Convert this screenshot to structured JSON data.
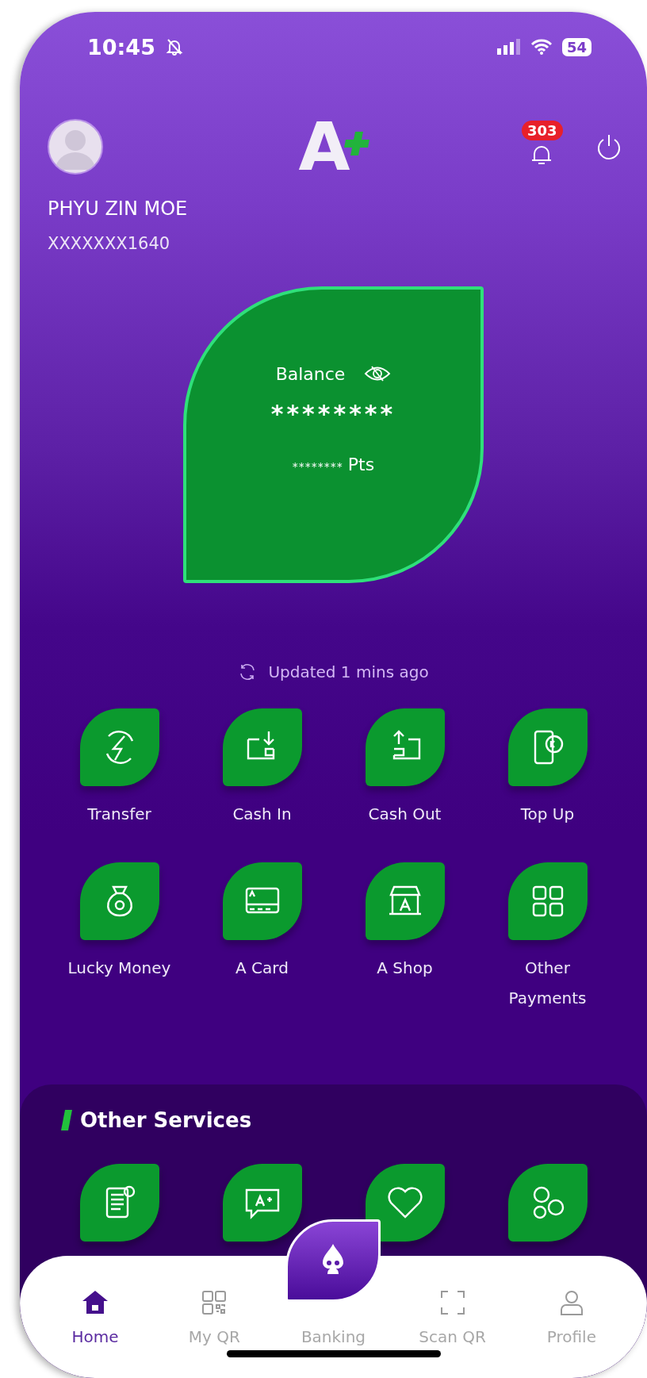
{
  "status_bar": {
    "time": "10:45",
    "battery": "54"
  },
  "header": {
    "logo_letter": "A",
    "notification_count": "303"
  },
  "user": {
    "name": "PHYU ZIN MOE",
    "account": "XXXXXXX1640"
  },
  "balance_card": {
    "label": "Balance",
    "amount": "********",
    "points": "********",
    "points_unit": "Pts"
  },
  "updated": "Updated 1 mins ago",
  "quick_actions": [
    {
      "label": "Transfer",
      "kind": "transfer"
    },
    {
      "label": "Cash In",
      "kind": "cash-in"
    },
    {
      "label": "Cash Out",
      "kind": "cash-out"
    },
    {
      "label": "Top Up",
      "kind": "top-up"
    },
    {
      "label": "Lucky Money",
      "kind": "money-bag"
    },
    {
      "label": "A Card",
      "kind": "card"
    },
    {
      "label": "A Shop",
      "kind": "shop"
    },
    {
      "label": "Other\nPayments",
      "kind": "grid"
    }
  ],
  "other_services": {
    "title": "Other Services",
    "items": [
      {
        "kind": "document"
      },
      {
        "kind": "chat"
      },
      {
        "kind": "heart"
      },
      {
        "kind": "coins"
      }
    ]
  },
  "bottom_nav": [
    {
      "label": "Home",
      "kind": "home",
      "selected": true
    },
    {
      "label": "My QR",
      "kind": "qr",
      "selected": false
    },
    {
      "label": "Banking",
      "kind": "banking",
      "selected": false
    },
    {
      "label": "Scan QR",
      "kind": "scan",
      "selected": false
    },
    {
      "label": "Profile",
      "kind": "profile",
      "selected": false
    }
  ]
}
